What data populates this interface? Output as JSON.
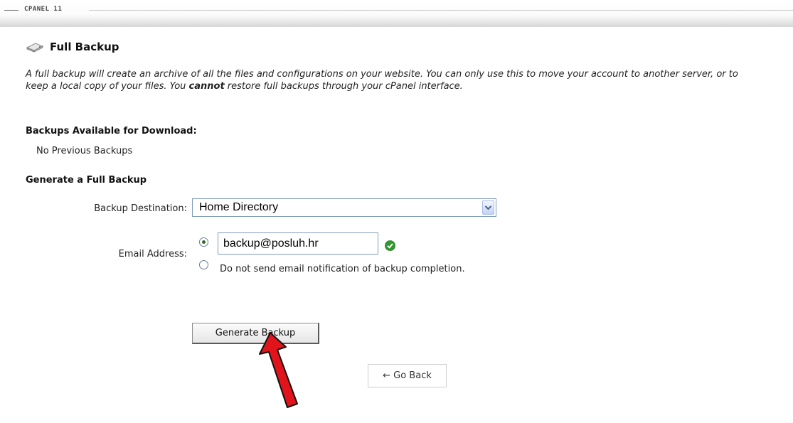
{
  "header": {
    "brand": "CPANEL 11"
  },
  "section": {
    "title": "Full Backup",
    "icon": "hard-drive-icon",
    "description_before": "A full backup will create an archive of all the files and configurations on your website. You can only use this to move your account to another server, or to keep a local copy of your files. You ",
    "description_emphasis": "cannot",
    "description_after": " restore full backups through your cPanel interface."
  },
  "backups": {
    "heading": "Backups Available for Download:",
    "empty_text": "No Previous Backups"
  },
  "generate": {
    "heading": "Generate a Full Backup",
    "destination_label": "Backup Destination:",
    "destination_value": "Home Directory",
    "email_label": "Email Address:",
    "email_value": "backup@posluh.hr",
    "no_email_option": "Do not send email notification of backup completion.",
    "button_label": "Generate Backup"
  },
  "nav": {
    "go_back": "← Go Back"
  },
  "colors": {
    "check": "#2e9a2e",
    "arrow": "#e0141a"
  }
}
